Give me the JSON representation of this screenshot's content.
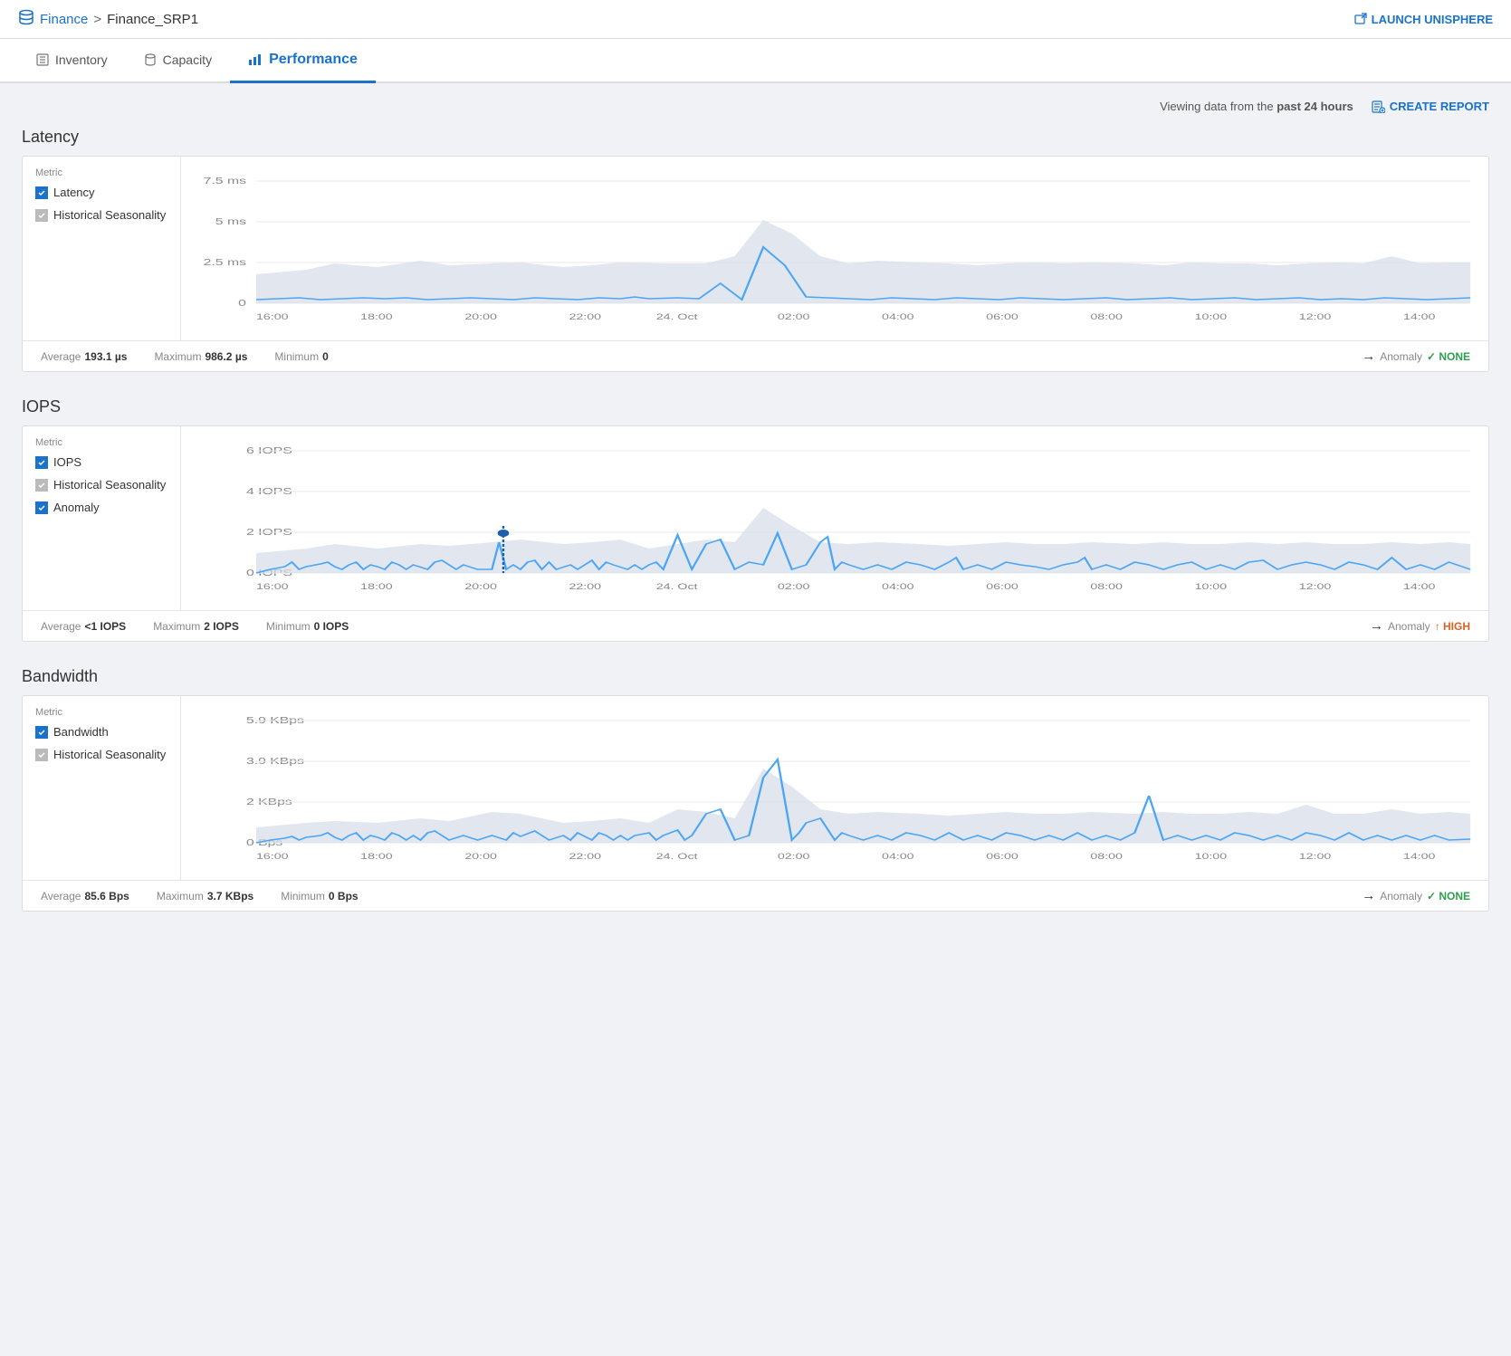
{
  "topbar": {
    "db_icon": "database-icon",
    "breadcrumb_parent": "Finance",
    "breadcrumb_separator": ">",
    "breadcrumb_current": "Finance_SRP1",
    "launch_btn_label": "LAUNCH UNISPHERE"
  },
  "tabs": [
    {
      "id": "inventory",
      "label": "Inventory",
      "icon": "list-icon",
      "active": false
    },
    {
      "id": "capacity",
      "label": "Capacity",
      "icon": "cylinder-icon",
      "active": false
    },
    {
      "id": "performance",
      "label": "Performance",
      "icon": "chart-icon",
      "active": true
    }
  ],
  "toolbar": {
    "viewing_text": "Viewing data from the",
    "viewing_bold": "past 24 hours",
    "create_report_label": "CREATE REPORT"
  },
  "sections": [
    {
      "id": "latency",
      "title": "Latency",
      "metrics": [
        {
          "label": "Latency",
          "checked": "blue"
        },
        {
          "label": "Historical Seasonality",
          "checked": "gray"
        }
      ],
      "footer": {
        "average_label": "Average",
        "average_val": "193.1 µs",
        "maximum_label": "Maximum",
        "maximum_val": "986.2 µs",
        "minimum_label": "Minimum",
        "minimum_val": "0",
        "anomaly_label": "Anomaly",
        "anomaly_val": "NONE",
        "anomaly_type": "none"
      },
      "y_labels": [
        "7.5 ms",
        "5 ms",
        "2.5 ms",
        "0"
      ],
      "x_labels": [
        "16:00",
        "18:00",
        "20:00",
        "22:00",
        "24. Oct",
        "02:00",
        "04:00",
        "06:00",
        "08:00",
        "10:00",
        "12:00",
        "14:00"
      ]
    },
    {
      "id": "iops",
      "title": "IOPS",
      "metrics": [
        {
          "label": "IOPS",
          "checked": "blue"
        },
        {
          "label": "Historical Seasonality",
          "checked": "gray"
        },
        {
          "label": "Anomaly",
          "checked": "blue"
        }
      ],
      "footer": {
        "average_label": "Average",
        "average_val": "<1 IOPS",
        "maximum_label": "Maximum",
        "maximum_val": "2 IOPS",
        "minimum_label": "Minimum",
        "minimum_val": "0 IOPS",
        "anomaly_label": "Anomaly",
        "anomaly_val": "HIGH",
        "anomaly_type": "high"
      },
      "y_labels": [
        "6 IOPS",
        "4 IOPS",
        "2 IOPS",
        "0 IOPS"
      ],
      "x_labels": [
        "16:00",
        "18:00",
        "20:00",
        "22:00",
        "24. Oct",
        "02:00",
        "04:00",
        "06:00",
        "08:00",
        "10:00",
        "12:00",
        "14:00"
      ]
    },
    {
      "id": "bandwidth",
      "title": "Bandwidth",
      "metrics": [
        {
          "label": "Bandwidth",
          "checked": "blue"
        },
        {
          "label": "Historical Seasonality",
          "checked": "gray"
        }
      ],
      "footer": {
        "average_label": "Average",
        "average_val": "85.6 Bps",
        "maximum_label": "Maximum",
        "maximum_val": "3.7 KBps",
        "minimum_label": "Minimum",
        "minimum_val": "0 Bps",
        "anomaly_label": "Anomaly",
        "anomaly_val": "NONE",
        "anomaly_type": "none"
      },
      "y_labels": [
        "5.9 KBps",
        "3.9 KBps",
        "2 KBps",
        "0 Bps"
      ],
      "x_labels": [
        "16:00",
        "18:00",
        "20:00",
        "22:00",
        "24. Oct",
        "02:00",
        "04:00",
        "06:00",
        "08:00",
        "10:00",
        "12:00",
        "14:00"
      ]
    }
  ]
}
